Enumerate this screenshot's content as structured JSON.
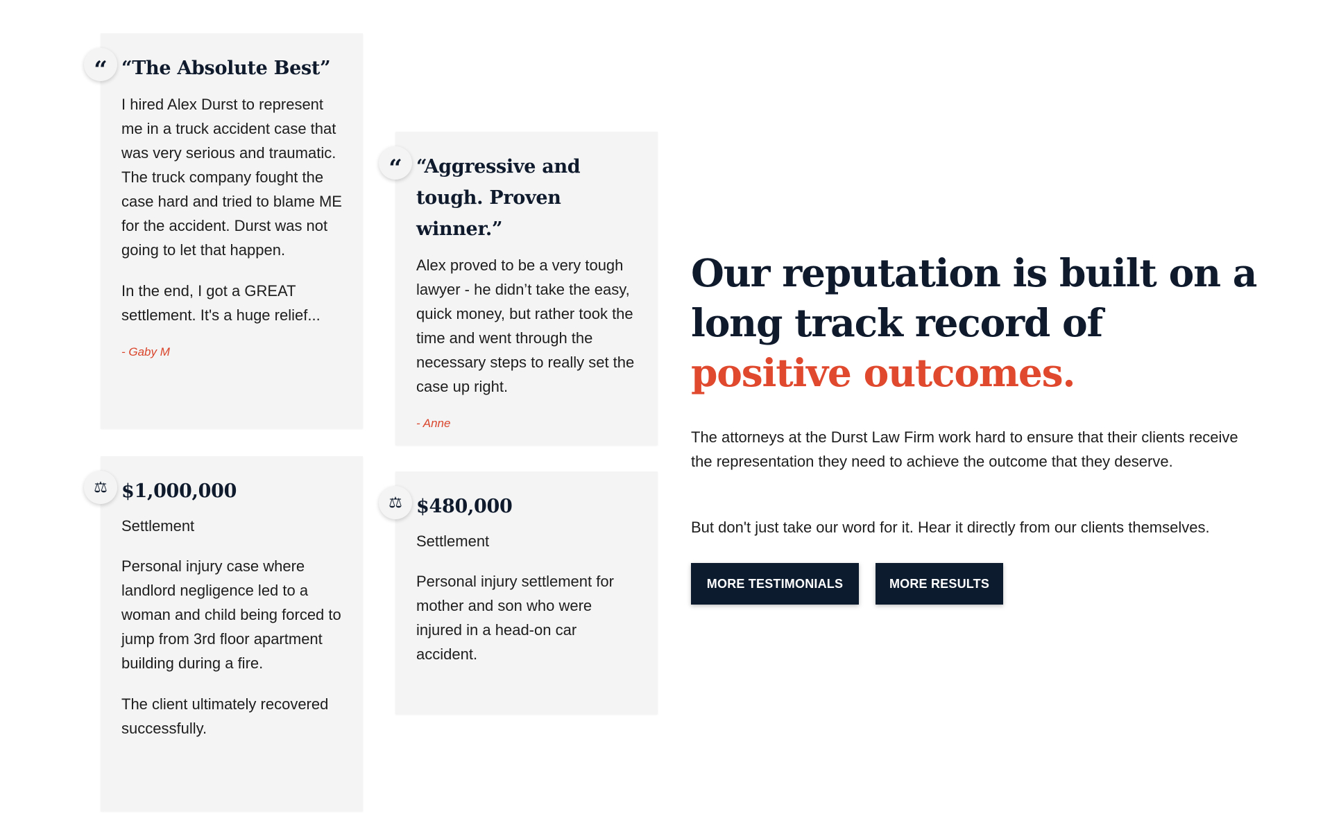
{
  "testimonials": [
    {
      "title": "“The Absolute Best”",
      "paragraphs": [
        "I hired Alex Durst to represent me in a truck accident case that was very serious and traumatic. The truck company fought the case hard and tried to blame ME for the accident. Durst was not going to let that happen.",
        "In the end, I got a GREAT settlement. It's a huge relief..."
      ],
      "author": "- Gaby M"
    },
    {
      "title": "“Aggressive and tough. Proven winner.”",
      "paragraphs": [
        "Alex proved to be a very tough lawyer - he didn’t take the easy, quick money, but rather took the time and went through the necessary steps to really set the case up right."
      ],
      "author": "- Anne"
    }
  ],
  "results": [
    {
      "amount": "$1,000,000",
      "type": "Settlement",
      "paragraphs": [
        "Personal injury case where landlord negligence led to a woman and child being forced to jump from 3rd floor apartment building during a fire.",
        "The client ultimately recovered successfully."
      ]
    },
    {
      "amount": "$480,000",
      "type": "Settlement",
      "paragraphs": [
        "Personal injury settlement for mother and son who were injured in a head-on car accident."
      ]
    }
  ],
  "icons": {
    "quote": "quote-icon",
    "scales": "scales-icon",
    "quote_glyph": "“",
    "scales_glyph": "⚖"
  },
  "hero": {
    "headline_main": "Our reputation is built on a long track record of ",
    "headline_accent": "positive outcomes.",
    "paragraph_1": "The attorneys at the Durst Law Firm work hard to ensure that their clients receive the representation they need to achieve the outcome that they deserve.",
    "paragraph_2": "But don't just take our word for it. Hear it directly from our clients themselves.",
    "button_testimonials": "MORE TESTIMONIALS",
    "button_results": "MORE RESULTS"
  },
  "colors": {
    "navy": "#0f1b2d",
    "accent": "#e0492e",
    "card_bg": "#f4f4f4"
  }
}
